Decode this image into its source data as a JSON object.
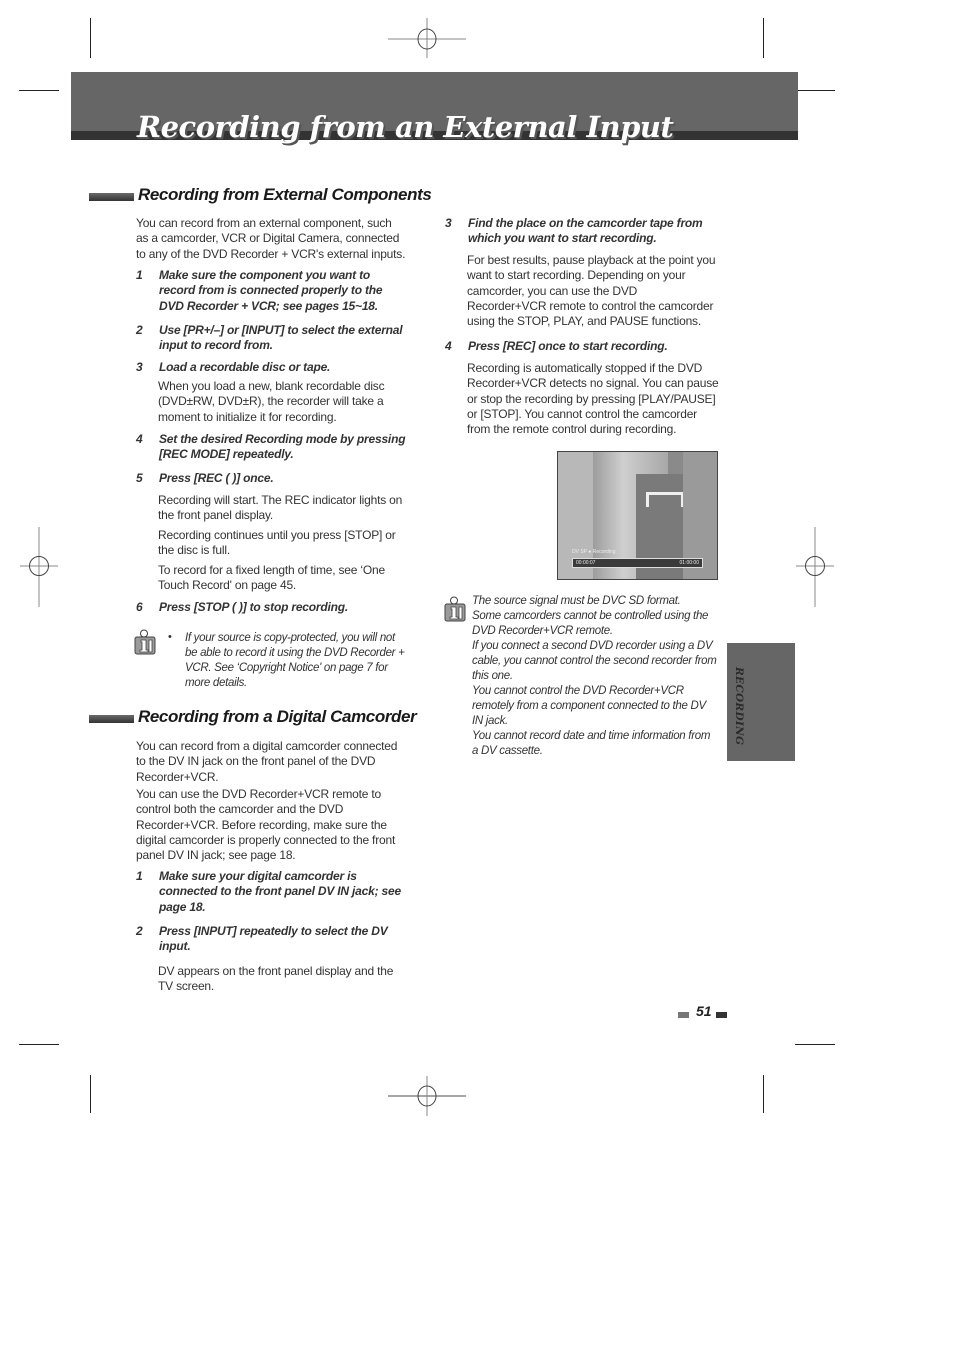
{
  "header": {
    "title": "Recording from an External Input"
  },
  "sections": [
    {
      "heading": "Recording from External Components",
      "intro": "You can record from an external component, such as a camcorder, VCR or Digital Camera, connected to any of the DVD Recorder + VCR's external inputs.",
      "steps": [
        {
          "num": "1",
          "text": "Make sure the component you want to record from is connected properly to the DVD Recorder + VCR; see pages 15~18."
        },
        {
          "num": "2",
          "text": "Use [PR+/–] or [INPUT] to select the external input to record from."
        },
        {
          "num": "3",
          "text": "Load a recordable disc or tape.",
          "body": [
            "When you load a new, blank recordable disc (DVD±RW, DVD±R), the recorder will take a moment to initialize it for recording."
          ]
        },
        {
          "num": "4",
          "text": "Set the desired Recording mode by pressing [REC MODE] repeatedly."
        },
        {
          "num": "5",
          "text": "Press [REC (    )] once.",
          "body": [
            "Recording will start. The REC indicator lights on the front panel display.",
            "Recording continues until you press [STOP] or the disc is full.",
            "To record for a fixed length of time, see ‘One Touch Record' on page 45."
          ]
        },
        {
          "num": "6",
          "text": "Press [STOP (    )] to stop recording."
        }
      ],
      "note": {
        "bullet": "•",
        "text": "If your source is copy-protected, you will not be able to record it using the DVD Recorder + VCR. See ‘Copyright Notice' on page 7 for more details."
      }
    },
    {
      "heading": "Recording from a Digital Camcorder",
      "intro": [
        "You can record from a digital camcorder connected to the DV IN jack on the front panel of the DVD Recorder+VCR.",
        "You can use the DVD Recorder+VCR remote to control both the camcorder and the DVD Recorder+VCR. Before recording, make sure the digital camcorder is properly connected to the front panel DV IN jack; see page 18."
      ],
      "steps": [
        {
          "num": "1",
          "text": "Make sure your digital camcorder is connected to the front panel DV IN jack; see page 18."
        },
        {
          "num": "2",
          "text": "Press [INPUT] repeatedly to select the DV input.",
          "body": [
            "DV appears on the front panel display and the TV screen."
          ]
        },
        {
          "num": "3",
          "text": "Find the place on the camcorder tape from which you want to start recording.",
          "body": [
            "For best results, pause playback at the point you want to start recording. Depending on your camcorder, you can use the DVD Recorder+VCR remote to control the camcorder using the STOP, PLAY, and PAUSE functions."
          ]
        },
        {
          "num": "4",
          "text": "Press [REC] once to start recording.",
          "body": [
            "Recording is automatically stopped if the DVD Recorder+VCR detects no signal.  You can pause or stop the recording by pressing [PLAY/PAUSE] or [STOP]. You cannot control the camcorder from the remote control during recording."
          ]
        }
      ],
      "screen": {
        "osd_status": "DV   SP   ●   Recording",
        "time_elapsed": "00:00:07",
        "time_total": "01:00:00"
      },
      "notes": [
        "The source signal must be DVC SD format.",
        "Some camcorders cannot be controlled using the DVD Recorder+VCR remote.",
        "If you connect a second DVD recorder using a DV cable, you cannot control the second recorder from this one.",
        "You cannot control the DVD Recorder+VCR remotely from a component connected to the DV IN jack.",
        "You cannot record date and time information from a DV cassette."
      ]
    }
  ],
  "side_tab": {
    "label": "RECORDING"
  },
  "footer": {
    "page_number": "51"
  },
  "icons": {
    "info": "info-note-icon",
    "registration": "registration-mark-icon"
  }
}
